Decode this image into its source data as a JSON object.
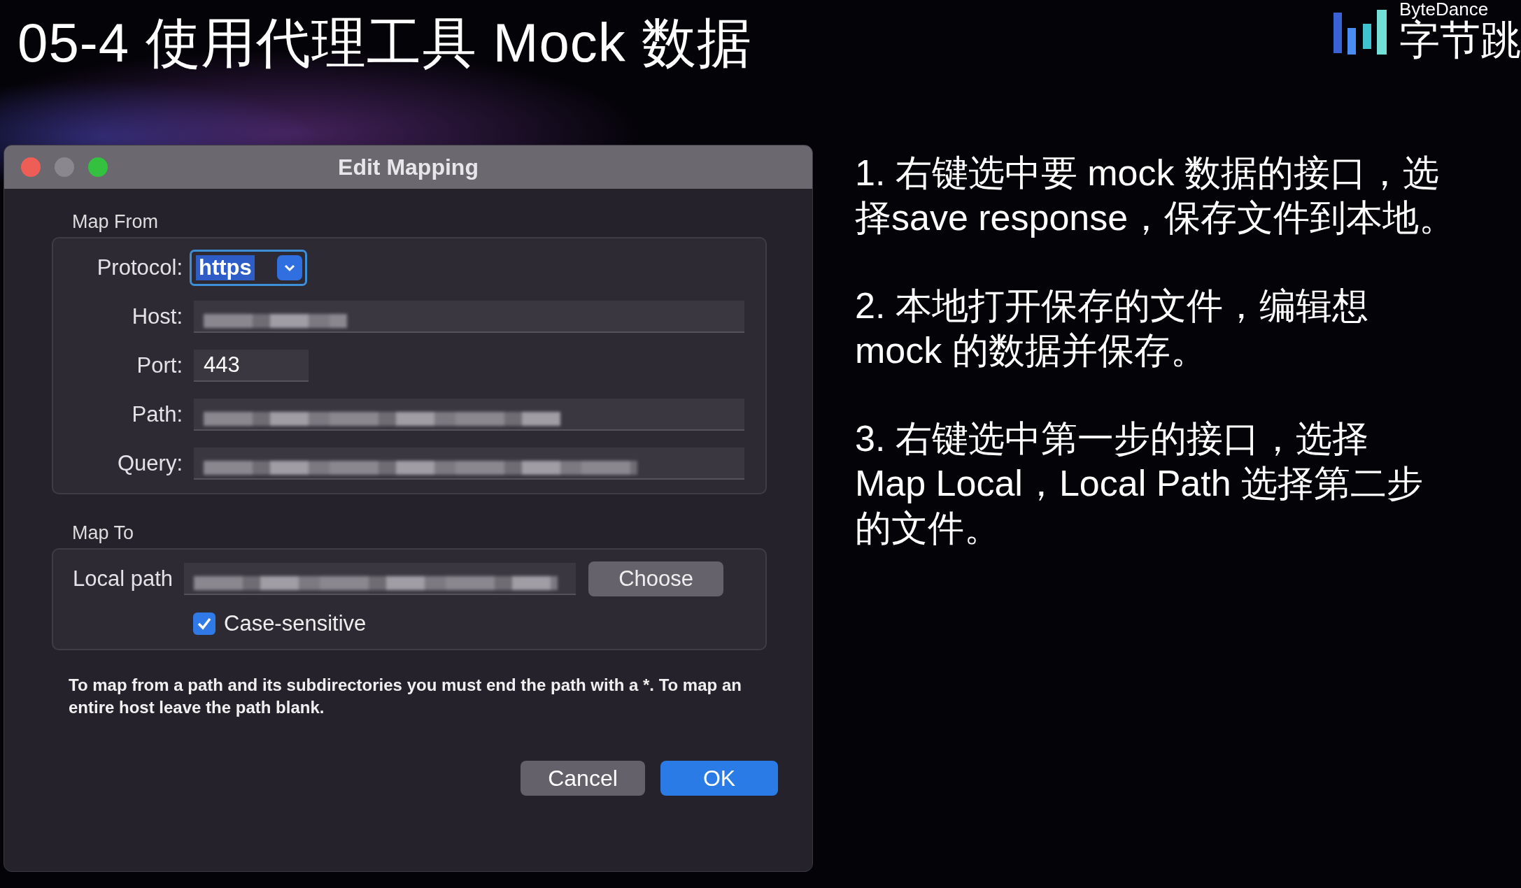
{
  "slide": {
    "title": "05-4 使用代理工具 Mock 数据"
  },
  "logo": {
    "wordmark": "ByteDance",
    "name": "字节跳"
  },
  "dialog": {
    "title": "Edit Mapping",
    "map_from": {
      "label": "Map From",
      "fields": [
        {
          "kind": "select",
          "label": "Protocol:",
          "value": "https"
        },
        {
          "kind": "blurred",
          "label": "Host:"
        },
        {
          "kind": "text",
          "label": "Port:",
          "value": "443"
        },
        {
          "kind": "blurred",
          "label": "Path:"
        },
        {
          "kind": "blurred",
          "label": "Query:"
        }
      ]
    },
    "map_to": {
      "label": "Map To",
      "local_path_label": "Local path",
      "choose_button": "Choose",
      "case_sensitive": {
        "label": "Case-sensitive",
        "checked": true
      }
    },
    "note": "To map from a path and its subdirectories you must end the path with a *. To map an entire host leave the path blank.",
    "buttons": [
      {
        "label": "Cancel",
        "kind": "secondary"
      },
      {
        "label": "OK",
        "kind": "primary"
      }
    ]
  },
  "steps": [
    {
      "lines": [
        "1. 右键选中要 mock 数据的接口，选",
        "择save response，保存文件到本地。"
      ]
    },
    {
      "lines": [
        "2. 本地打开保存的文件，编辑想",
        "mock 的数据并保存。"
      ]
    },
    {
      "lines": [
        "3. 右键选中第一步的接口，选择",
        "Map Local，Local Path 选择第二步",
        "的文件。"
      ]
    }
  ]
}
